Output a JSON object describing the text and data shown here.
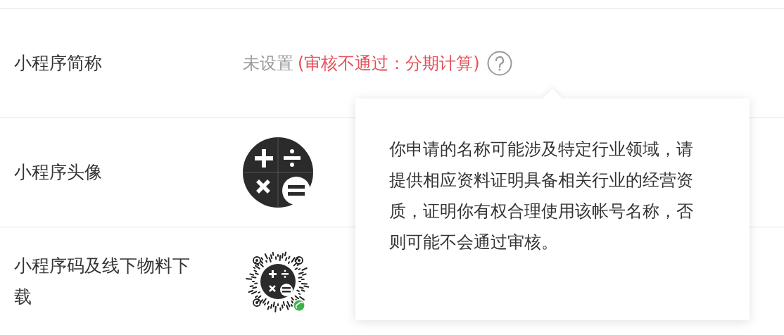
{
  "rows": [
    {
      "label": "小程序简称",
      "kind": "status",
      "value": "未设置",
      "status": "(审核不通过：分期计算)"
    },
    {
      "label": "小程序头像",
      "kind": "avatar"
    },
    {
      "label": "小程序码及线下物料下载",
      "kind": "code"
    }
  ],
  "tooltip": {
    "text": "你申请的名称可能涉及特定行业领域，请提供相应资料证明具备相关行业的经营资质，证明你有权合理使用该帐号名称，否则可能不会通过审核。"
  }
}
